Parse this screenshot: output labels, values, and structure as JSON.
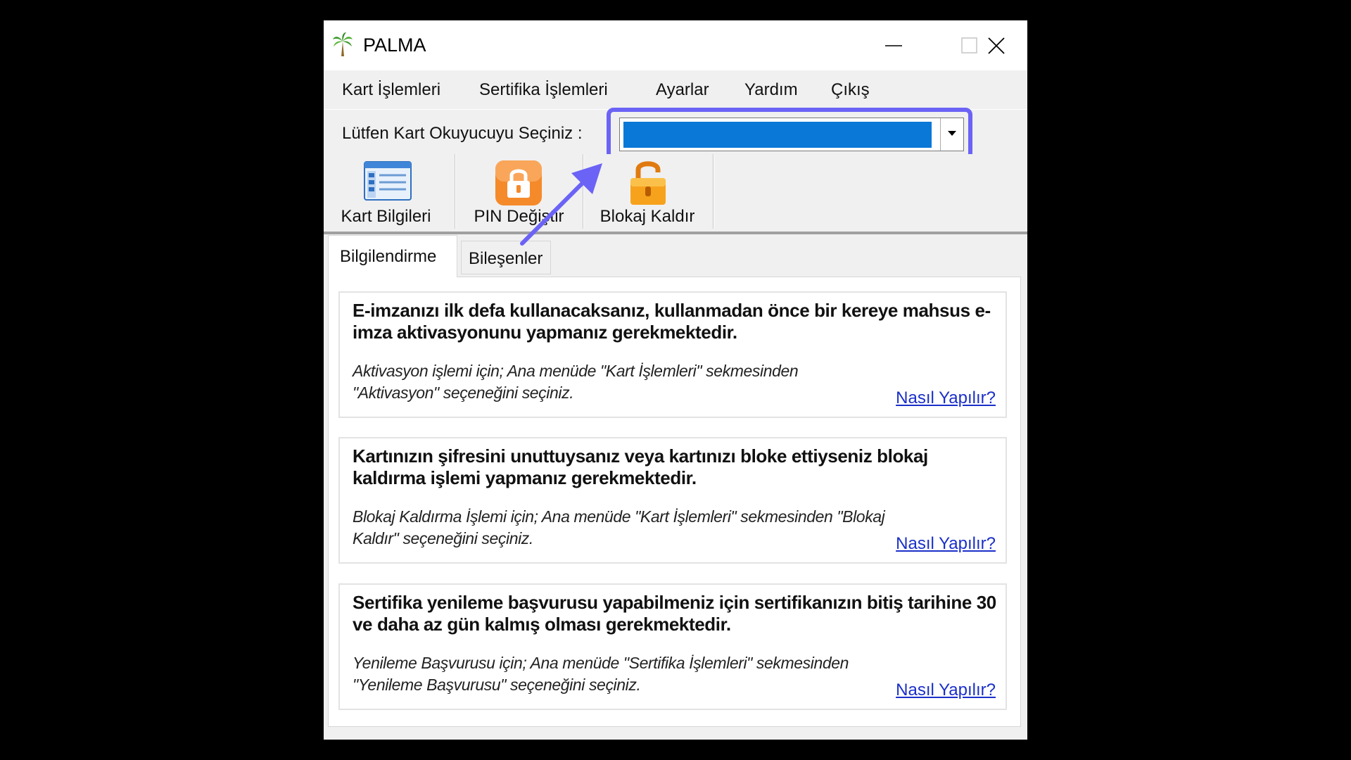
{
  "window": {
    "title": "PALMA",
    "icon": "palm-tree-icon"
  },
  "menu": {
    "items": [
      "Kart İşlemleri",
      "Sertifika İşlemleri",
      "Ayarlar",
      "Yardım",
      "Çıkış"
    ]
  },
  "reader": {
    "label": "Lütfen Kart Okuyucuyu Seçiniz :",
    "selected_value": "",
    "selected_color": "#0a78d7",
    "highlight_color": "#6b63f5"
  },
  "toolbar": {
    "buttons": [
      {
        "label": "Kart Bilgileri",
        "icon": "card-info-icon"
      },
      {
        "label": "PIN Değiştir",
        "icon": "lock-closed-icon"
      },
      {
        "label": "Blokaj Kaldır",
        "icon": "lock-open-icon"
      }
    ]
  },
  "tabs": {
    "active": "Bilgilendirme",
    "inactive": "Bileşenler"
  },
  "cards": [
    {
      "title": "E-imzanızı ilk defa kullanacaksanız, kullanmadan önce bir kereye mahsus e-imza aktivasyonunu yapmanız gerekmektedir.",
      "description": "Aktivasyon işlemi için; Ana menüde \"Kart İşlemleri\" sekmesinden \"Aktivasyon\" seçeneğini seçiniz.",
      "link": "Nasıl Yapılır?"
    },
    {
      "title": "Kartınızın şifresini unuttuysanız veya kartınızı bloke ettiyseniz blokaj kaldırma işlemi yapmanız gerekmektedir.",
      "description": "Blokaj Kaldırma İşlemi için; Ana menüde \"Kart İşlemleri\" sekmesinden \"Blokaj Kaldır\" seçeneğini seçiniz.",
      "link": "Nasıl Yapılır?"
    },
    {
      "title": "Sertifika yenileme başvurusu yapabilmeniz için sertifikanızın bitiş tarihine 30 ve daha az gün kalmış olması gerekmektedir.",
      "description": "Yenileme Başvurusu için; Ana menüde \"Sertifika İşlemleri\" sekmesinden \"Yenileme Başvurusu\" seçeneğini seçiniz.",
      "link": "Nasıl Yapılır?"
    }
  ],
  "annotation": {
    "arrow_color": "#6b63f5"
  }
}
